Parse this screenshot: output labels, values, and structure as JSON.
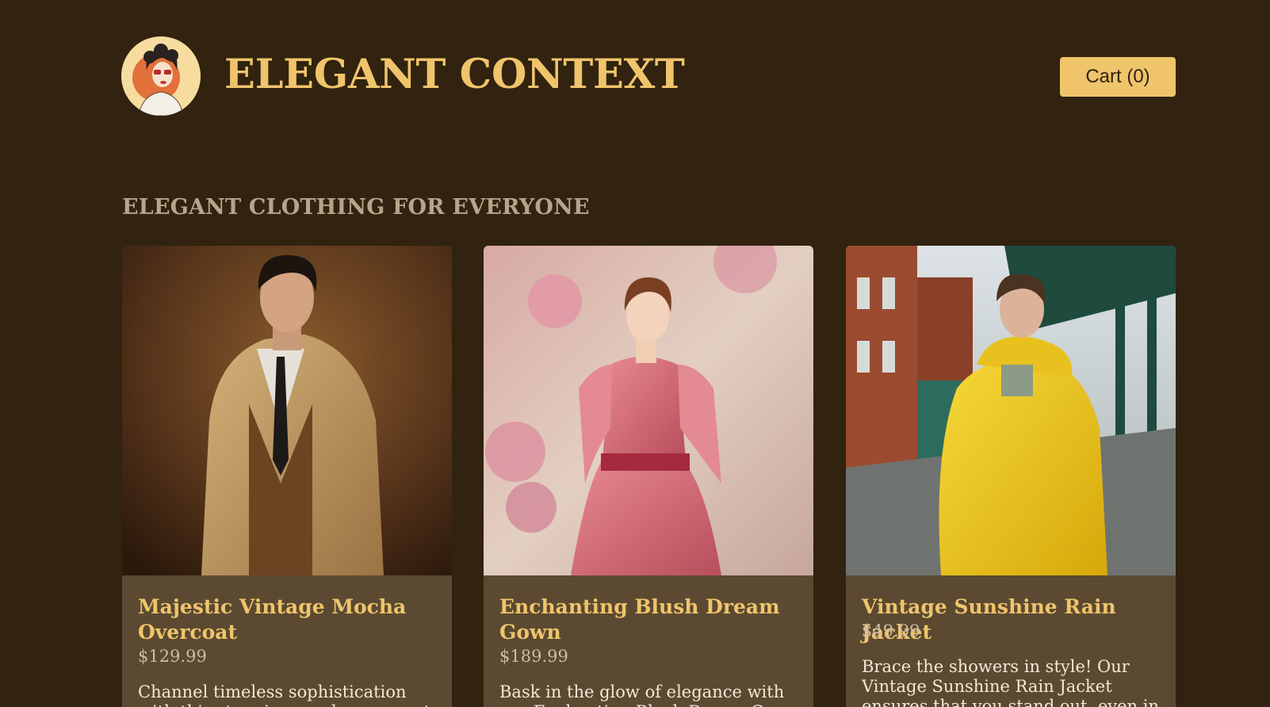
{
  "header": {
    "brand": "ELEGANT CONTEXT",
    "cart_label": "Cart (0)",
    "logo_icon": "vintage-woman-portrait-logo"
  },
  "section": {
    "title": "ELEGANT CLOTHING FOR EVERYONE"
  },
  "products": [
    {
      "name": "Majestic Vintage Mocha Overcoat",
      "price": "$129.99",
      "description": "Channel timeless sophistication with this stunning mocha overcoat"
    },
    {
      "name": "Enchanting Blush Dream Gown",
      "price": "$189.99",
      "description": "Bask in the glow of elegance with our Enchanting Blush Dream Gown"
    },
    {
      "name": "Vintage Sunshine Rain Jacket",
      "price": "$49.99",
      "description": "Brace the showers in style! Our Vintage Sunshine Rain Jacket ensures that you stand out, even in the dullest"
    }
  ],
  "colors": {
    "background": "#31230f",
    "accent": "#efc46b",
    "card": "#5b4a31"
  }
}
